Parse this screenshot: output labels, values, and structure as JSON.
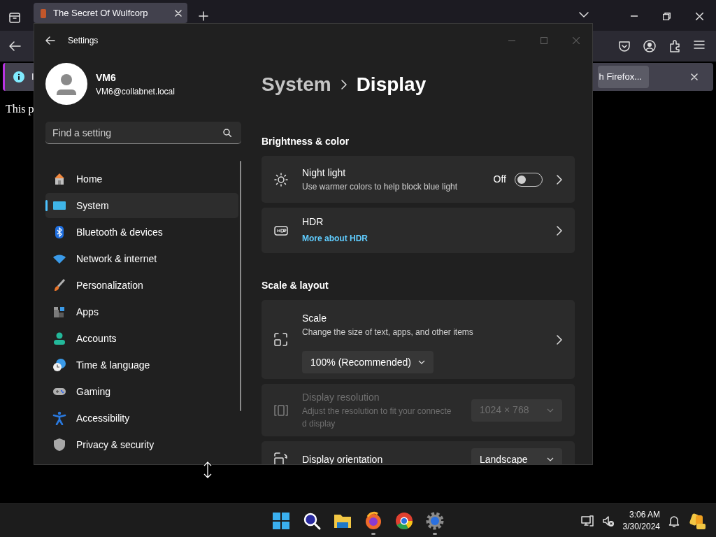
{
  "browser": {
    "tab_title": "The Secret Of Wulfcorp",
    "notification": {
      "text": "I",
      "button": "h Firefox..."
    },
    "page_text": "This p"
  },
  "settings": {
    "title": "Settings",
    "user": {
      "name": "VM6",
      "email": "VM6@collabnet.local"
    },
    "search": {
      "placeholder": "Find a setting"
    },
    "nav": [
      {
        "label": "Home",
        "selected": false
      },
      {
        "label": "System",
        "selected": true
      },
      {
        "label": "Bluetooth & devices",
        "selected": false
      },
      {
        "label": "Network & internet",
        "selected": false
      },
      {
        "label": "Personalization",
        "selected": false
      },
      {
        "label": "Apps",
        "selected": false
      },
      {
        "label": "Accounts",
        "selected": false
      },
      {
        "label": "Time & language",
        "selected": false
      },
      {
        "label": "Gaming",
        "selected": false
      },
      {
        "label": "Accessibility",
        "selected": false
      },
      {
        "label": "Privacy & security",
        "selected": false
      }
    ],
    "breadcrumb": {
      "parent": "System",
      "current": "Display"
    },
    "sections": [
      {
        "title": "Brightness & color",
        "items": [
          {
            "kind": "toggle",
            "title": "Night light",
            "subtitle": "Use warmer colors to help block blue light",
            "state_label": "Off",
            "on": false,
            "disabled": false
          },
          {
            "kind": "link",
            "title": "HDR",
            "link": "More about HDR",
            "disabled": false
          }
        ]
      },
      {
        "title": "Scale & layout",
        "items": [
          {
            "kind": "dropdown-below",
            "title": "Scale",
            "subtitle": "Change the size of text, apps, and other items",
            "value": "100% (Recommended)",
            "disabled": false
          },
          {
            "kind": "dropdown",
            "title": "Display resolution",
            "subtitle": "Adjust the resolution to fit your connecte d display",
            "value": "1024 × 768",
            "disabled": true
          },
          {
            "kind": "dropdown",
            "title": "Display orientation",
            "value": "Landscape",
            "disabled": false
          }
        ]
      }
    ]
  },
  "taskbar": {
    "apps": [
      {
        "running": false
      },
      {
        "running": false
      },
      {
        "running": false
      },
      {
        "running": true
      },
      {
        "running": false
      },
      {
        "running": true
      }
    ],
    "time": "3:06 AM",
    "date": "3/30/2024"
  }
}
